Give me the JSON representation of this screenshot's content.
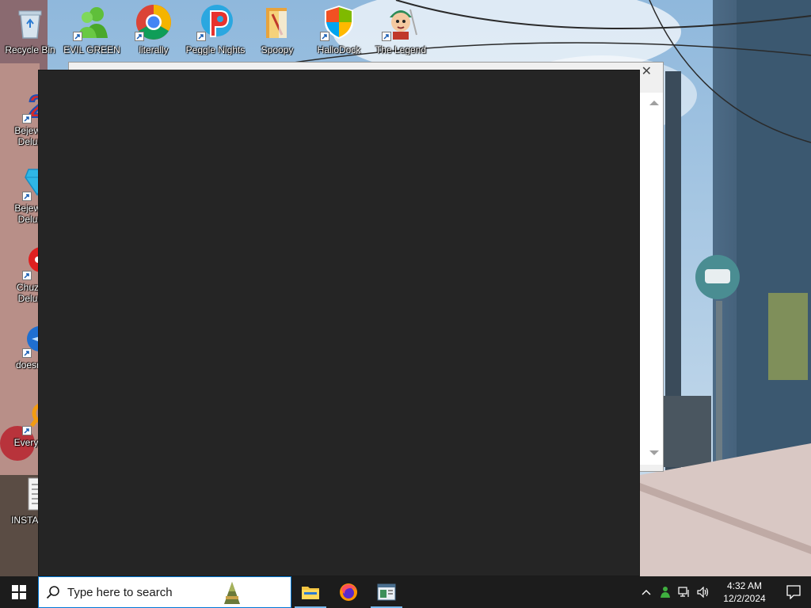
{
  "desktop": {
    "top_icons": [
      {
        "name": "recycle-bin",
        "label": "Recycle Bin",
        "icon": "recycle-bin-icon",
        "shortcut": false
      },
      {
        "name": "evil-green",
        "label": "EVIL GREEN",
        "icon": "msn-buddy-icon",
        "shortcut": true
      },
      {
        "name": "literally",
        "label": "literally",
        "icon": "chrome-icon",
        "shortcut": true
      },
      {
        "name": "peggle-nights",
        "label": "Peggle Nights",
        "icon": "peggle-icon",
        "shortcut": true
      },
      {
        "name": "spoopy",
        "label": "Spoopy",
        "icon": "folder-icon",
        "shortcut": false
      },
      {
        "name": "hallodock",
        "label": "HalloDock",
        "icon": "windows-shield-icon",
        "shortcut": true
      },
      {
        "name": "the-legend",
        "label": "The Legend",
        "icon": "game-character-icon",
        "shortcut": true
      }
    ],
    "left_icons": [
      {
        "name": "bejeweled-2",
        "label": "Bejewe",
        "label2": "Delux",
        "icon": "bejeweled-2-icon"
      },
      {
        "name": "bejeweled",
        "label": "Bejewe",
        "label2": "Delux",
        "icon": "diamond-icon"
      },
      {
        "name": "chuzzle",
        "label": "Chuzz",
        "label2": "Delux",
        "icon": "chuzzle-icon"
      },
      {
        "name": "doesnt",
        "label": "doesnt",
        "label2": "",
        "icon": "thunderbird-icon"
      },
      {
        "name": "everything",
        "label": "Everyth",
        "label2": "",
        "icon": "everything-search-icon"
      },
      {
        "name": "install",
        "label": "INSTALL",
        "label2": "",
        "icon": "text-document-icon"
      }
    ]
  },
  "background_dialog": {
    "close_glyph": "✕"
  },
  "taskbar": {
    "search_placeholder": "Type here to search",
    "apps": [
      {
        "name": "file-explorer",
        "icon": "folder-icon",
        "active": true
      },
      {
        "name": "firefox",
        "icon": "firefox-icon",
        "active": false
      },
      {
        "name": "console-app",
        "icon": "window-app-icon",
        "active": true
      }
    ],
    "clock": {
      "time": "4:32 AM",
      "date": "12/2/2024"
    }
  },
  "colors": {
    "taskbar_bg": "#1c1c1c",
    "dark_window": "#252525",
    "search_border": "#0078d7"
  }
}
